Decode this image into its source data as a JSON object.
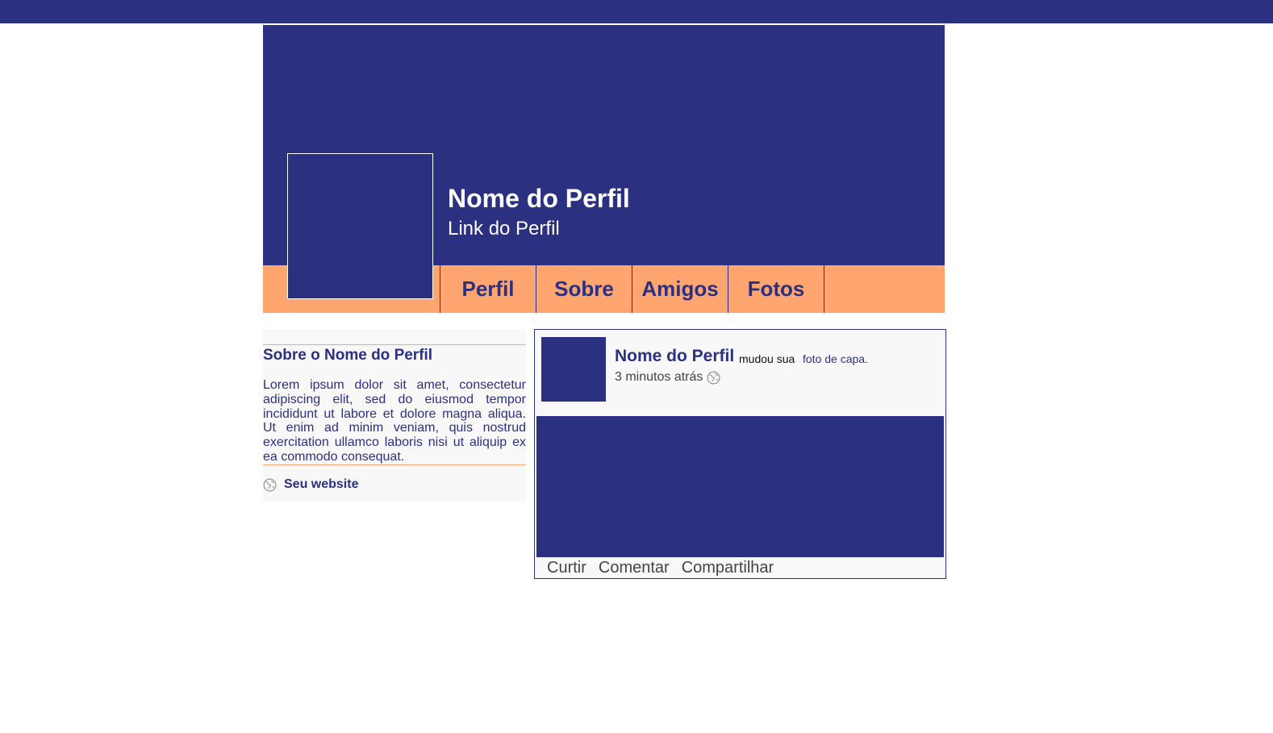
{
  "header": {
    "profile_name": "Nome do Perfil",
    "profile_link": "Link do Perfil"
  },
  "nav": {
    "tabs": [
      {
        "label": "Perfil"
      },
      {
        "label": "Sobre"
      },
      {
        "label": "Amigos"
      },
      {
        "label": "Fotos"
      }
    ]
  },
  "about": {
    "title": "Sobre o Nome do Perfil",
    "text": "Lorem ipsum dolor sit amet, consectetur adipiscing elit, sed do eiusmod tempor incididunt ut labore et dolore magna aliqua. Ut enim ad minim veniam, quis nostrud exercitation ullamco laboris nisi ut aliquip ex ea commodo consequat.",
    "website_label": "Seu website",
    "website_icon": "globe-icon"
  },
  "post": {
    "author": "Nome do Perfil",
    "action": "mudou sua",
    "link": "foto de capa.",
    "time": "3 minutos atrás",
    "time_icon": "globe-icon",
    "actions": {
      "like": "Curtir",
      "comment": "Comentar",
      "share": "Compartilhar"
    }
  },
  "colors": {
    "primary": "#2c3081",
    "accent": "#ffa56f",
    "panel": "#f8f8f8"
  }
}
